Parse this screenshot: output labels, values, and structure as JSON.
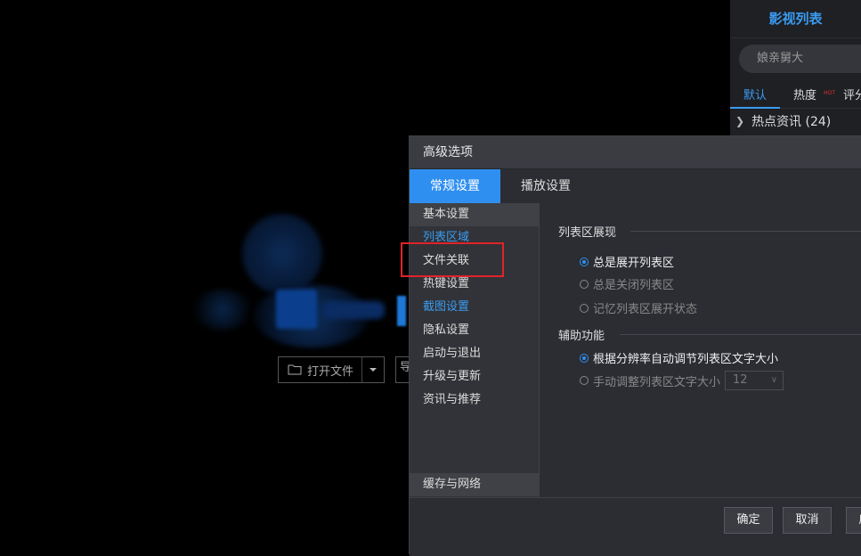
{
  "player": {
    "open_file_label": "打开文件",
    "second_button_label": "导"
  },
  "list_panel": {
    "title": "影视列表",
    "search_placeholder": "娘亲舅大",
    "tabs": [
      {
        "label": "默认"
      },
      {
        "label": "热度",
        "badge": "HOT"
      },
      {
        "label": "评分"
      }
    ],
    "category": "热点资讯 (24)"
  },
  "dialog": {
    "title": "高级选项",
    "tabs": [
      "常规设置",
      "播放设置"
    ],
    "sidebar": [
      "基本设置",
      "列表区域",
      "文件关联",
      "热键设置",
      "截图设置",
      "隐私设置",
      "启动与退出",
      "升级与更新",
      "资讯与推荐",
      "缓存与网络"
    ],
    "section1": {
      "title": "列表区展现",
      "options": [
        "总是展开列表区",
        "总是关闭列表区",
        "记忆列表区展开状态"
      ]
    },
    "section2": {
      "title": "辅助功能",
      "options": [
        "根据分辨率自动调节列表区文字大小",
        "手动调整列表区文字大小"
      ],
      "font_size_value": "12"
    },
    "buttons": {
      "ok": "确定",
      "cancel": "取消",
      "apply": "应用"
    }
  },
  "colors": {
    "accent": "#2f8ff0",
    "highlight_box": "#e0232a"
  }
}
